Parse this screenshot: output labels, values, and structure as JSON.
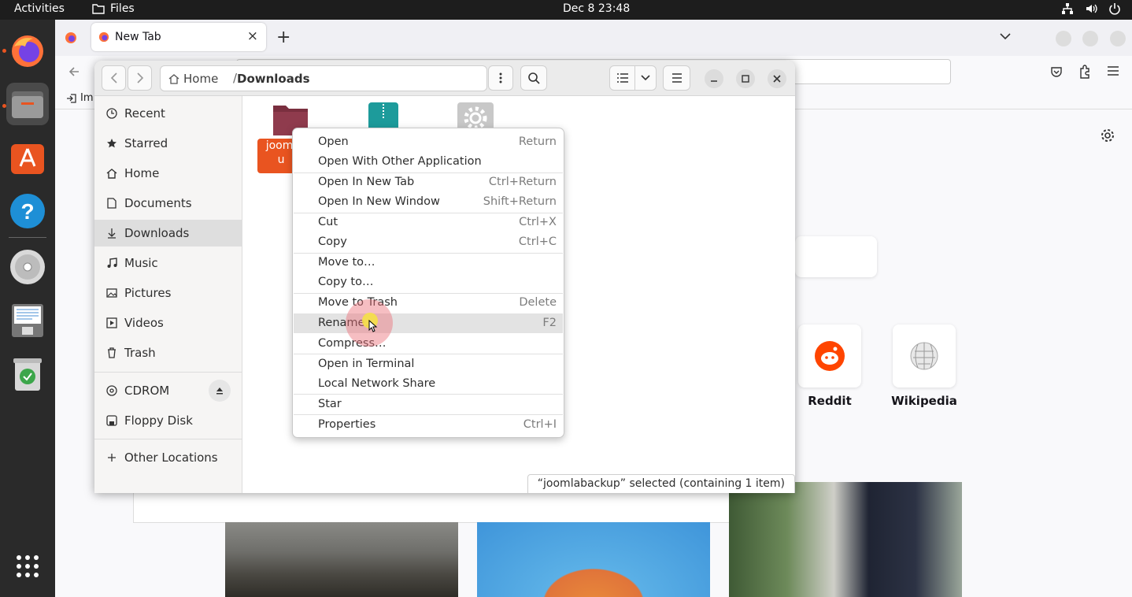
{
  "topbar": {
    "activities": "Activities",
    "app_name": "Files",
    "clock": "Dec 8  23:48"
  },
  "dock": {
    "apps": [
      "firefox-icon",
      "files-icon",
      "software-icon",
      "help-icon",
      "disc-icon",
      "text-editor-icon",
      "trash-icon",
      "show-apps-icon"
    ]
  },
  "firefox": {
    "tab_title": "New Tab",
    "bookmark_partial": "Im",
    "sites": [
      {
        "label": "Reddit"
      },
      {
        "label": "Wikipedia"
      }
    ]
  },
  "files": {
    "path_home": "Home",
    "path_separator": "/",
    "path_current": "Downloads",
    "sidebar": [
      {
        "label": "Recent",
        "icon": "clock-icon"
      },
      {
        "label": "Starred",
        "icon": "star-icon"
      },
      {
        "label": "Home",
        "icon": "home-icon"
      },
      {
        "label": "Documents",
        "icon": "document-icon"
      },
      {
        "label": "Downloads",
        "icon": "download-icon",
        "selected": true
      },
      {
        "label": "Music",
        "icon": "music-icon"
      },
      {
        "label": "Pictures",
        "icon": "picture-icon"
      },
      {
        "label": "Videos",
        "icon": "video-icon"
      },
      {
        "label": "Trash",
        "icon": "trash-icon"
      }
    ],
    "devices": [
      {
        "label": "CDROM",
        "icon": "disc-icon"
      },
      {
        "label": "Floppy Disk",
        "icon": "floppy-icon"
      }
    ],
    "other_locations": "Other Locations",
    "selected_file_label_partial_1": "jooml",
    "selected_file_label_partial_2": "u",
    "status": "“joomlabackup” selected  (containing 1 item)"
  },
  "context_menu": [
    {
      "label": "Open",
      "shortcut": "Return"
    },
    {
      "label": "Open With Other Application",
      "shortcut": ""
    },
    {
      "label": "Open In New Tab",
      "shortcut": "Ctrl+Return"
    },
    {
      "label": "Open In New Window",
      "shortcut": "Shift+Return"
    },
    {
      "label": "Cut",
      "shortcut": "Ctrl+X"
    },
    {
      "label": "Copy",
      "shortcut": "Ctrl+C"
    },
    {
      "label": "Move to…",
      "shortcut": ""
    },
    {
      "label": "Copy to…",
      "shortcut": ""
    },
    {
      "label": "Move to Trash",
      "shortcut": "Delete"
    },
    {
      "label": "Rename…",
      "shortcut": "F2",
      "highlighted": true
    },
    {
      "label": "Compress…",
      "shortcut": ""
    },
    {
      "label": "Open in Terminal",
      "shortcut": ""
    },
    {
      "label": "Local Network Share",
      "shortcut": ""
    },
    {
      "label": "Star",
      "shortcut": ""
    },
    {
      "label": "Properties",
      "shortcut": "Ctrl+I"
    }
  ],
  "colors": {
    "ubuntu_orange": "#e95420",
    "folder_selected_bg": "#e95420",
    "topbar_bg": "#1d1d1d",
    "dock_bg": "#2a2a2a"
  }
}
